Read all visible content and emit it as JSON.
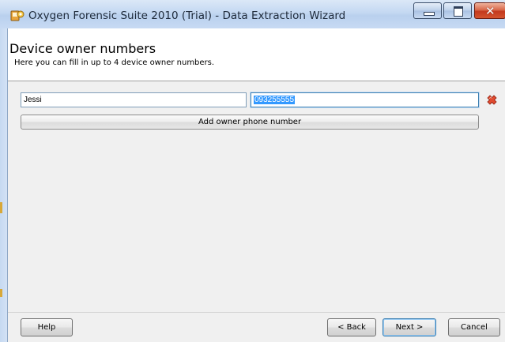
{
  "window": {
    "title": "Oxygen Forensic Suite 2010 (Trial) - Data Extraction Wizard"
  },
  "header": {
    "title": "Device owner numbers",
    "subtitle": "Here you can fill in up to 4 device owner numbers."
  },
  "owner_rows": [
    {
      "name": "Jessi",
      "phone": "093255555"
    }
  ],
  "buttons": {
    "add_phone": "Add owner phone number",
    "help": "Help",
    "back": "< Back",
    "next": "Next >",
    "cancel": "Cancel"
  },
  "icons": {
    "app": "oxygen-app-icon",
    "remove": "red-x-delete-icon",
    "minimize": "minimize-icon",
    "maximize": "maximize-icon",
    "close": "close-icon"
  },
  "colors": {
    "titlebar": "#c4d8f2",
    "close_button": "#c3391e",
    "selection": "#3399ff",
    "remove_icon": "#d9452c"
  }
}
